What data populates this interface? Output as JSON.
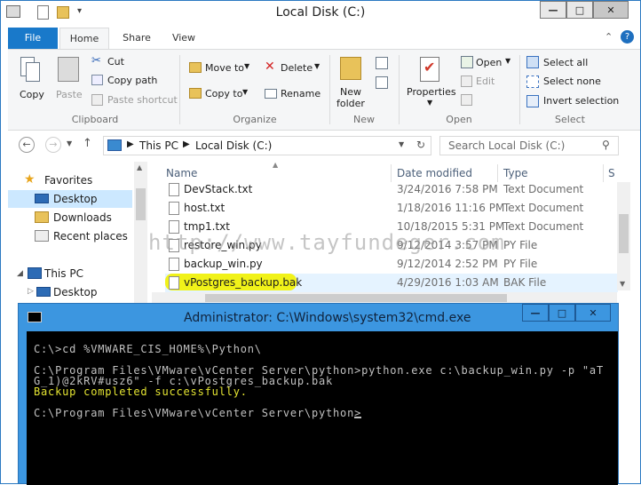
{
  "window": {
    "title": "Local Disk (C:)"
  },
  "quick_access": {
    "dropdown": "▾"
  },
  "window_buttons": {
    "minimize": "—",
    "maximize": "□",
    "close": "✕"
  },
  "ribbon_tabs": {
    "file": "File",
    "home": "Home",
    "share": "Share",
    "view": "View"
  },
  "ribbon": {
    "clipboard": {
      "copy": "Copy",
      "paste": "Paste",
      "cut": "Cut",
      "copy_path": "Copy path",
      "paste_shortcut": "Paste shortcut",
      "label": "Clipboard"
    },
    "organize": {
      "move_to": "Move to",
      "copy_to": "Copy to",
      "delete": "Delete",
      "rename": "Rename",
      "label": "Organize"
    },
    "new": {
      "new_folder_1": "New",
      "new_folder_2": "folder",
      "label": "New"
    },
    "open": {
      "properties": "Properties",
      "open": "Open",
      "edit": "Edit",
      "label": "Open"
    },
    "select": {
      "select_all": "Select all",
      "select_none": "Select none",
      "invert": "Invert selection",
      "label": "Select"
    }
  },
  "address": {
    "this_pc": "This PC",
    "local_disk": "Local Disk (C:)",
    "search_placeholder": "Search Local Disk (C:)"
  },
  "nav": {
    "favorites": "Favorites",
    "desktop": "Desktop",
    "downloads": "Downloads",
    "recent": "Recent places",
    "this_pc": "This PC",
    "pc_desktop": "Desktop"
  },
  "columns": {
    "name": "Name",
    "date": "Date modified",
    "type": "Type",
    "size": "S"
  },
  "files": [
    {
      "name": "DevStack.txt",
      "date": "3/24/2016 7:58 PM",
      "type": "Text Document"
    },
    {
      "name": "host.txt",
      "date": "1/18/2016 11:16 PM",
      "type": "Text Document"
    },
    {
      "name": "tmp1.txt",
      "date": "10/18/2015 5:31 PM",
      "type": "Text Document"
    },
    {
      "name": "restore_win.py",
      "date": "9/12/2014 3:57 PM",
      "type": "PY File"
    },
    {
      "name": "backup_win.py",
      "date": "9/12/2014 2:52 PM",
      "type": "PY File"
    },
    {
      "name": "vPostgres_backup.bak",
      "date": "4/29/2016 1:03 AM",
      "type": "BAK File"
    }
  ],
  "watermark": "http://www.tayfundeger.com",
  "cmd": {
    "title": "Administrator: C:\\Windows\\system32\\cmd.exe",
    "lines": [
      "C:\\>cd %VMWARE_CIS_HOME%\\Python\\",
      "",
      "C:\\Program Files\\VMware\\vCenter Server\\python>python.exe c:\\backup_win.py -p \"aT",
      "G_1)@2kRV#usz6\" -f c:\\vPostgres_backup.bak",
      "Backup completed successfully.",
      "",
      "C:\\Program Files\\VMware\\vCenter Server\\python>"
    ]
  },
  "colors": {
    "file_tab": "#1979ca",
    "cmd_frame": "#3c96e0",
    "console_bg": "#000000",
    "console_text": "#c0c0c0",
    "success_text": "#e5e532",
    "highlight": "#f2f200"
  }
}
